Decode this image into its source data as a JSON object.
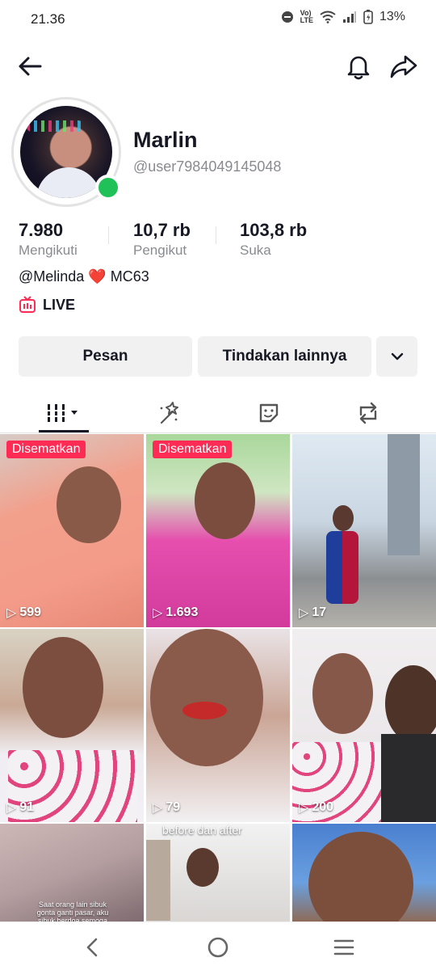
{
  "status_bar": {
    "time": "21.36",
    "battery": "13%",
    "network": "LTE"
  },
  "profile": {
    "display_name": "Marlin",
    "username": "@user7984049145048",
    "bio": "@Melinda ❤️ MC63",
    "bio_mention": "@Melinda",
    "bio_heart": "❤️",
    "bio_suffix": "MC63",
    "live_label": "LIVE",
    "online": true
  },
  "stats": [
    {
      "value": "7.980",
      "label": "Mengikuti"
    },
    {
      "value": "10,7 rb",
      "label": "Pengikut"
    },
    {
      "value": "103,8 rb",
      "label": "Suka"
    }
  ],
  "actions": {
    "message": "Pesan",
    "more_actions": "Tindakan lainnya"
  },
  "tabs": [
    {
      "name": "videos-tab",
      "icon": "grid-icon",
      "active": true
    },
    {
      "name": "reposts-tab",
      "icon": "sparkle-icon",
      "active": false
    },
    {
      "name": "stickers-tab",
      "icon": "sticker-icon",
      "active": false
    },
    {
      "name": "repost-tab",
      "icon": "repeat-icon",
      "active": false
    }
  ],
  "videos": [
    {
      "views": "599",
      "pinned": "Disematkan"
    },
    {
      "views": "1.693",
      "pinned": "Disematkan"
    },
    {
      "views": "17"
    },
    {
      "views": "91"
    },
    {
      "views": "79"
    },
    {
      "views": "200"
    },
    {
      "caption": "Saat orang lain sibuk gonta ganti pasar, aku sibuk berdoa semoga"
    },
    {
      "caption": "before dan after"
    },
    {}
  ],
  "colors": {
    "accent": "#fe2c55",
    "online": "#21c15a",
    "text": "#161823",
    "muted": "#8a8b91"
  }
}
